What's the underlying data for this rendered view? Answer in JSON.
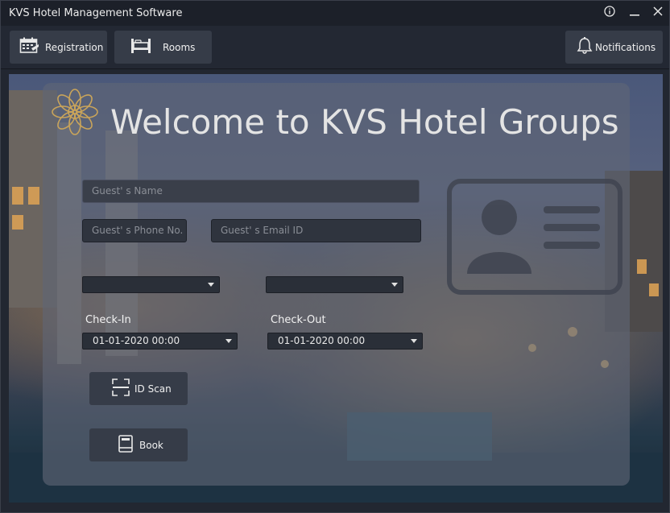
{
  "window": {
    "title": "KVS Hotel Management Software",
    "controls": [
      "info-icon",
      "minimize-icon",
      "close-icon"
    ]
  },
  "toolbar": {
    "registration_label": "Registration",
    "rooms_label": "Rooms",
    "notifications_label": "Notifications"
  },
  "main": {
    "welcome_title": "Welcome to KVS Hotel Groups",
    "guest_name_placeholder": "Guest' s Name",
    "guest_phone_placeholder": "Guest' s Phone No.",
    "guest_email_placeholder": "Guest' s Email ID",
    "combo1_value": "",
    "combo2_value": "",
    "checkin_label": "Check-In",
    "checkout_label": "Check-Out",
    "checkin_value": "01-01-2020 00:00",
    "checkout_value": "01-01-2020 00:00",
    "id_scan_label": "ID Scan",
    "book_label": "Book"
  },
  "colors": {
    "accent_gold": "#c9a45a",
    "panel": "#5f6676",
    "button": "#363c48"
  }
}
